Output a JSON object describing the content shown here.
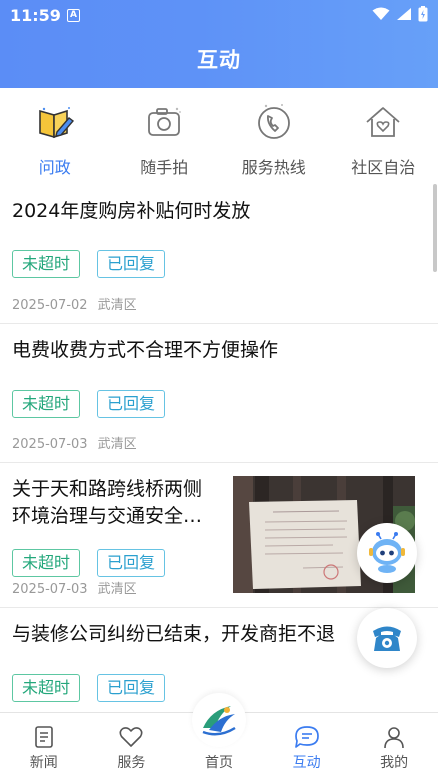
{
  "status_bar": {
    "time": "11:59",
    "notif_glyph": "A"
  },
  "header": {
    "title": "互动"
  },
  "categories": [
    {
      "label": "问政",
      "icon": "book-pen-icon",
      "active": true
    },
    {
      "label": "随手拍",
      "icon": "camera-icon",
      "active": false
    },
    {
      "label": "服务热线",
      "icon": "phone-icon",
      "active": false
    },
    {
      "label": "社区自治",
      "icon": "house-heart-icon",
      "active": false
    }
  ],
  "items": [
    {
      "title": "2024年度购房补贴何时发放",
      "tags": [
        "未超时",
        "已回复"
      ],
      "date": "2025-07-02",
      "district": "武清区"
    },
    {
      "title": "电费收费方式不合理不方便操作",
      "tags": [
        "未超时",
        "已回复"
      ],
      "date": "2025-07-03",
      "district": "武清区"
    },
    {
      "title_line1": "关于天和路跨线桥两侧",
      "title_line2": "环境治理与交通安全…",
      "tags": [
        "未超时",
        "已回复"
      ],
      "date": "2025-07-03",
      "district": "武清区",
      "has_image": true
    },
    {
      "title": "与装修公司纠纷已结束，开发商拒不退",
      "tags": [
        "未超时",
        "已回复"
      ]
    }
  ],
  "floating": {
    "robot": "robot-assistant-icon",
    "phone": "hotline-phone-icon"
  },
  "tabs": [
    {
      "label": "新闻",
      "icon": "news-icon",
      "active": false
    },
    {
      "label": "服务",
      "icon": "heart-icon",
      "active": false
    },
    {
      "label": "首页",
      "icon": "home-logo-icon",
      "active": false
    },
    {
      "label": "互动",
      "icon": "chat-icon",
      "active": true
    },
    {
      "label": "我的",
      "icon": "user-icon",
      "active": false
    }
  ],
  "colors": {
    "accent": "#3b7cf0",
    "tag_green": "#23a77b",
    "tag_blue": "#2ba0cf",
    "header_start": "#5b8df6",
    "header_end": "#67a0f8"
  }
}
